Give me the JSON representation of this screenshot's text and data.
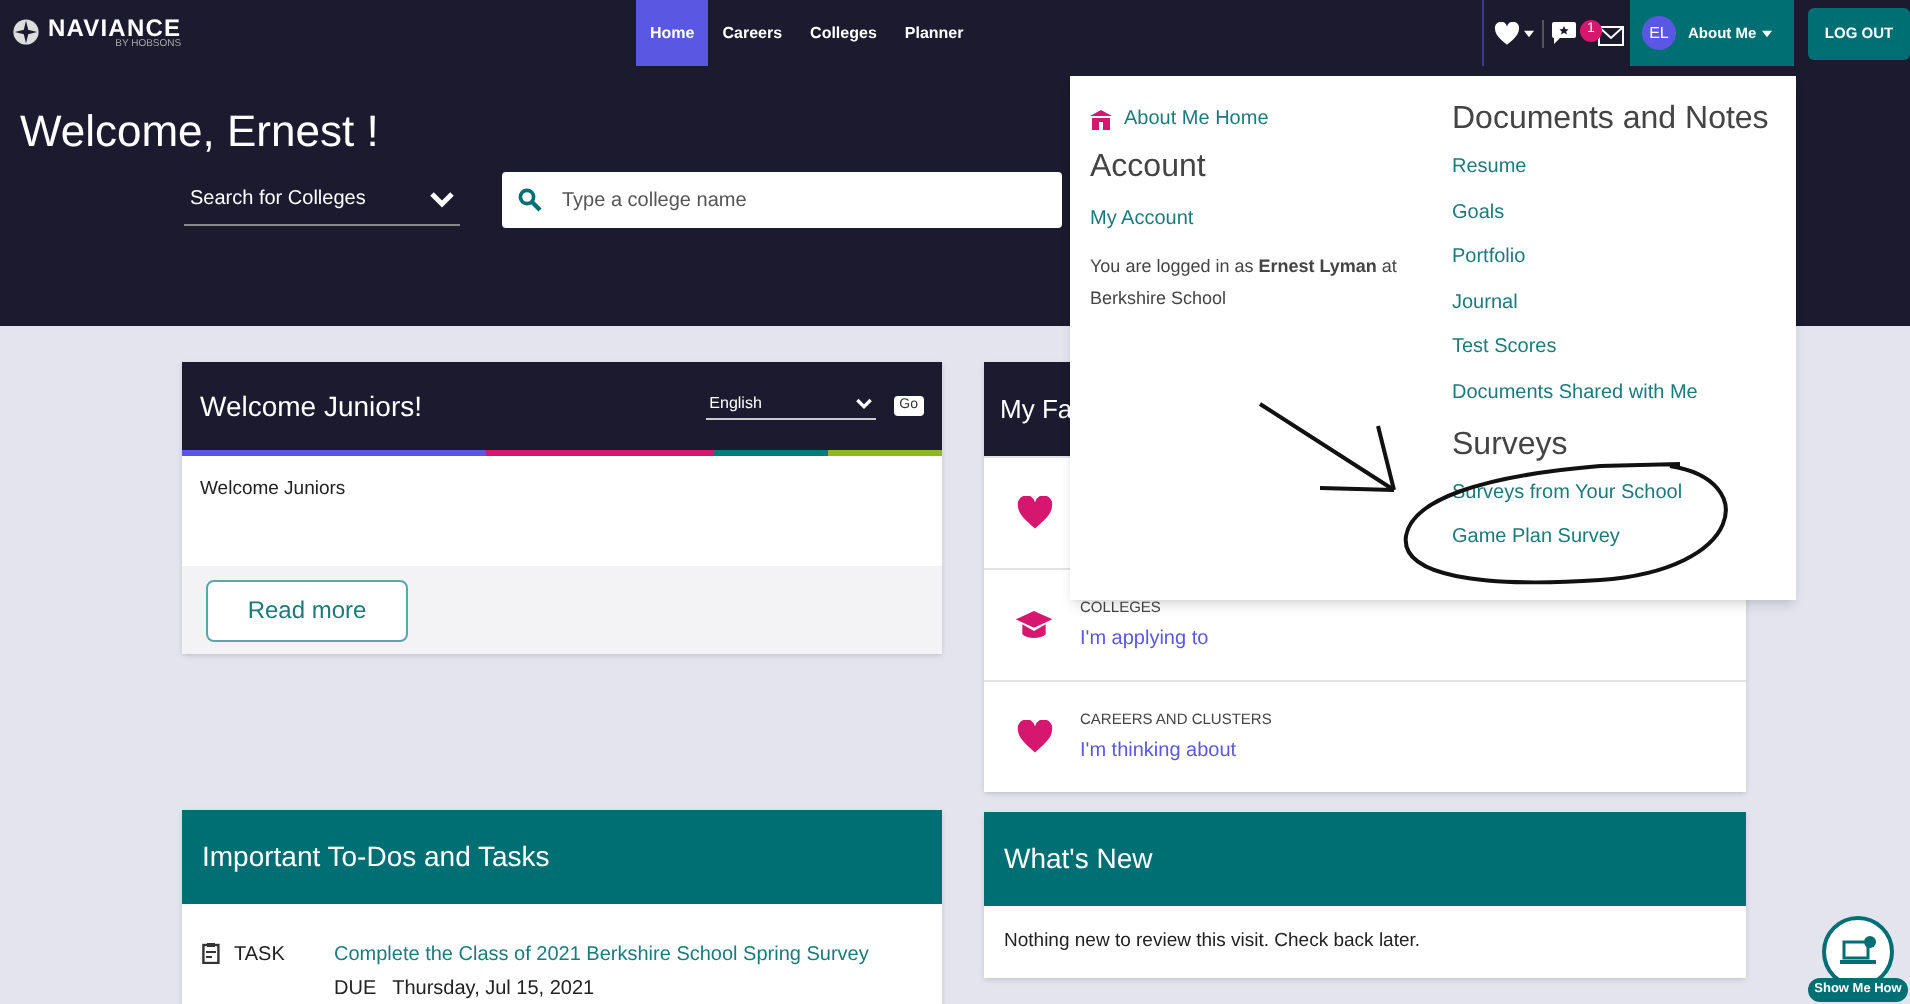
{
  "brand": {
    "name": "NAVIANCE",
    "tagline": "BY HOBSONS"
  },
  "nav": [
    {
      "label": "Home",
      "selected": true
    },
    {
      "label": "Careers",
      "selected": false
    },
    {
      "label": "Colleges",
      "selected": false
    },
    {
      "label": "Planner",
      "selected": false
    }
  ],
  "message_count": "1",
  "user": {
    "initials": "EL",
    "label": "About Me",
    "expanded": true
  },
  "logout": "LOG OUT",
  "hero": {
    "title": "Welcome, Ernest !",
    "search_type": "Search for Colleges",
    "search_placeholder": "Type a college name"
  },
  "welcome_card": {
    "title": "Welcome Juniors!",
    "language": "English",
    "go": "Go",
    "body": "Welcome Juniors",
    "button": "Read more"
  },
  "favorites_card": {
    "title": "My Fa",
    "rows": [
      {
        "kind": "heart"
      },
      {
        "kind": "cap",
        "category": "COLLEGES",
        "link": "I'm applying to"
      },
      {
        "kind": "heart",
        "category": "CAREERS AND CLUSTERS",
        "link": "I'm thinking about"
      }
    ]
  },
  "todos_card": {
    "title": "Important To-Dos and Tasks",
    "tasks": [
      {
        "type": "TASK",
        "title": "Complete the Class of 2021 Berkshire School Spring Survey",
        "due_label": "DUE",
        "due_date": "Thursday, Jul 15, 2021"
      }
    ]
  },
  "whats_new": {
    "title": "What's New",
    "body": "Nothing new to review this visit. Check back later."
  },
  "about_menu": {
    "home": "About Me Home",
    "account_heading": "Account",
    "account_links": [
      "My Account"
    ],
    "login_note": "You are logged in as **Ernest Lyman** at Berkshire School",
    "documents_heading": "Documents and Notes",
    "documents_links": [
      "Resume",
      "Goals",
      "Portfolio",
      "Journal",
      "Test Scores",
      "Documents Shared with Me"
    ],
    "surveys_heading": "Surveys",
    "survey_links": [
      "Surveys from Your School",
      "Game Plan Survey"
    ]
  },
  "show_me_how": "Show Me How"
}
